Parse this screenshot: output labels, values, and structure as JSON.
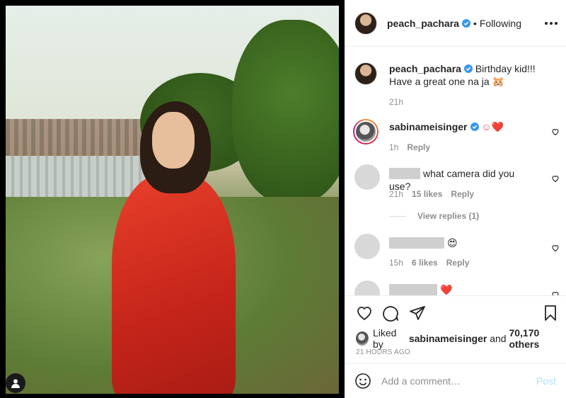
{
  "post": {
    "author": "peach_pachara",
    "follow_status": "Following",
    "separator": "•"
  },
  "caption": {
    "user": "peach_pachara",
    "text": "Birthday kid!!! Have a great one na ja 🐹",
    "time": "21h"
  },
  "comments": [
    {
      "user": "sabinameisinger",
      "text": "☺❤️",
      "time": "1h",
      "likes": "",
      "reply": "Reply"
    },
    {
      "user": "",
      "text": "what camera did you use?",
      "time": "21h",
      "likes": "15 likes",
      "reply": "Reply",
      "view_replies": "View replies (1)"
    },
    {
      "user": "",
      "text": "😍",
      "time": "15h",
      "likes": "6 likes",
      "reply": "Reply"
    },
    {
      "user": "",
      "text": "❤️",
      "time": "",
      "likes": "",
      "reply": ""
    }
  ],
  "likes": {
    "prefix": "Liked by",
    "user": "sabinameisinger",
    "and": "and",
    "count": "70,170 others"
  },
  "posted_ago": "21 HOURS AGO",
  "comment_box": {
    "placeholder": "Add a comment…",
    "post_label": "Post"
  },
  "colors": {
    "verified_blue": "#3897f0",
    "heart_red": "#ed4956",
    "muted_text": "#8e8e8e",
    "post_disabled": "#b2dffc"
  },
  "icons": {
    "like": "heart-icon",
    "comment": "speech-bubble-icon",
    "share": "paper-plane-icon",
    "save": "bookmark-icon",
    "more": "ellipsis-icon",
    "emoji": "smiley-icon"
  }
}
